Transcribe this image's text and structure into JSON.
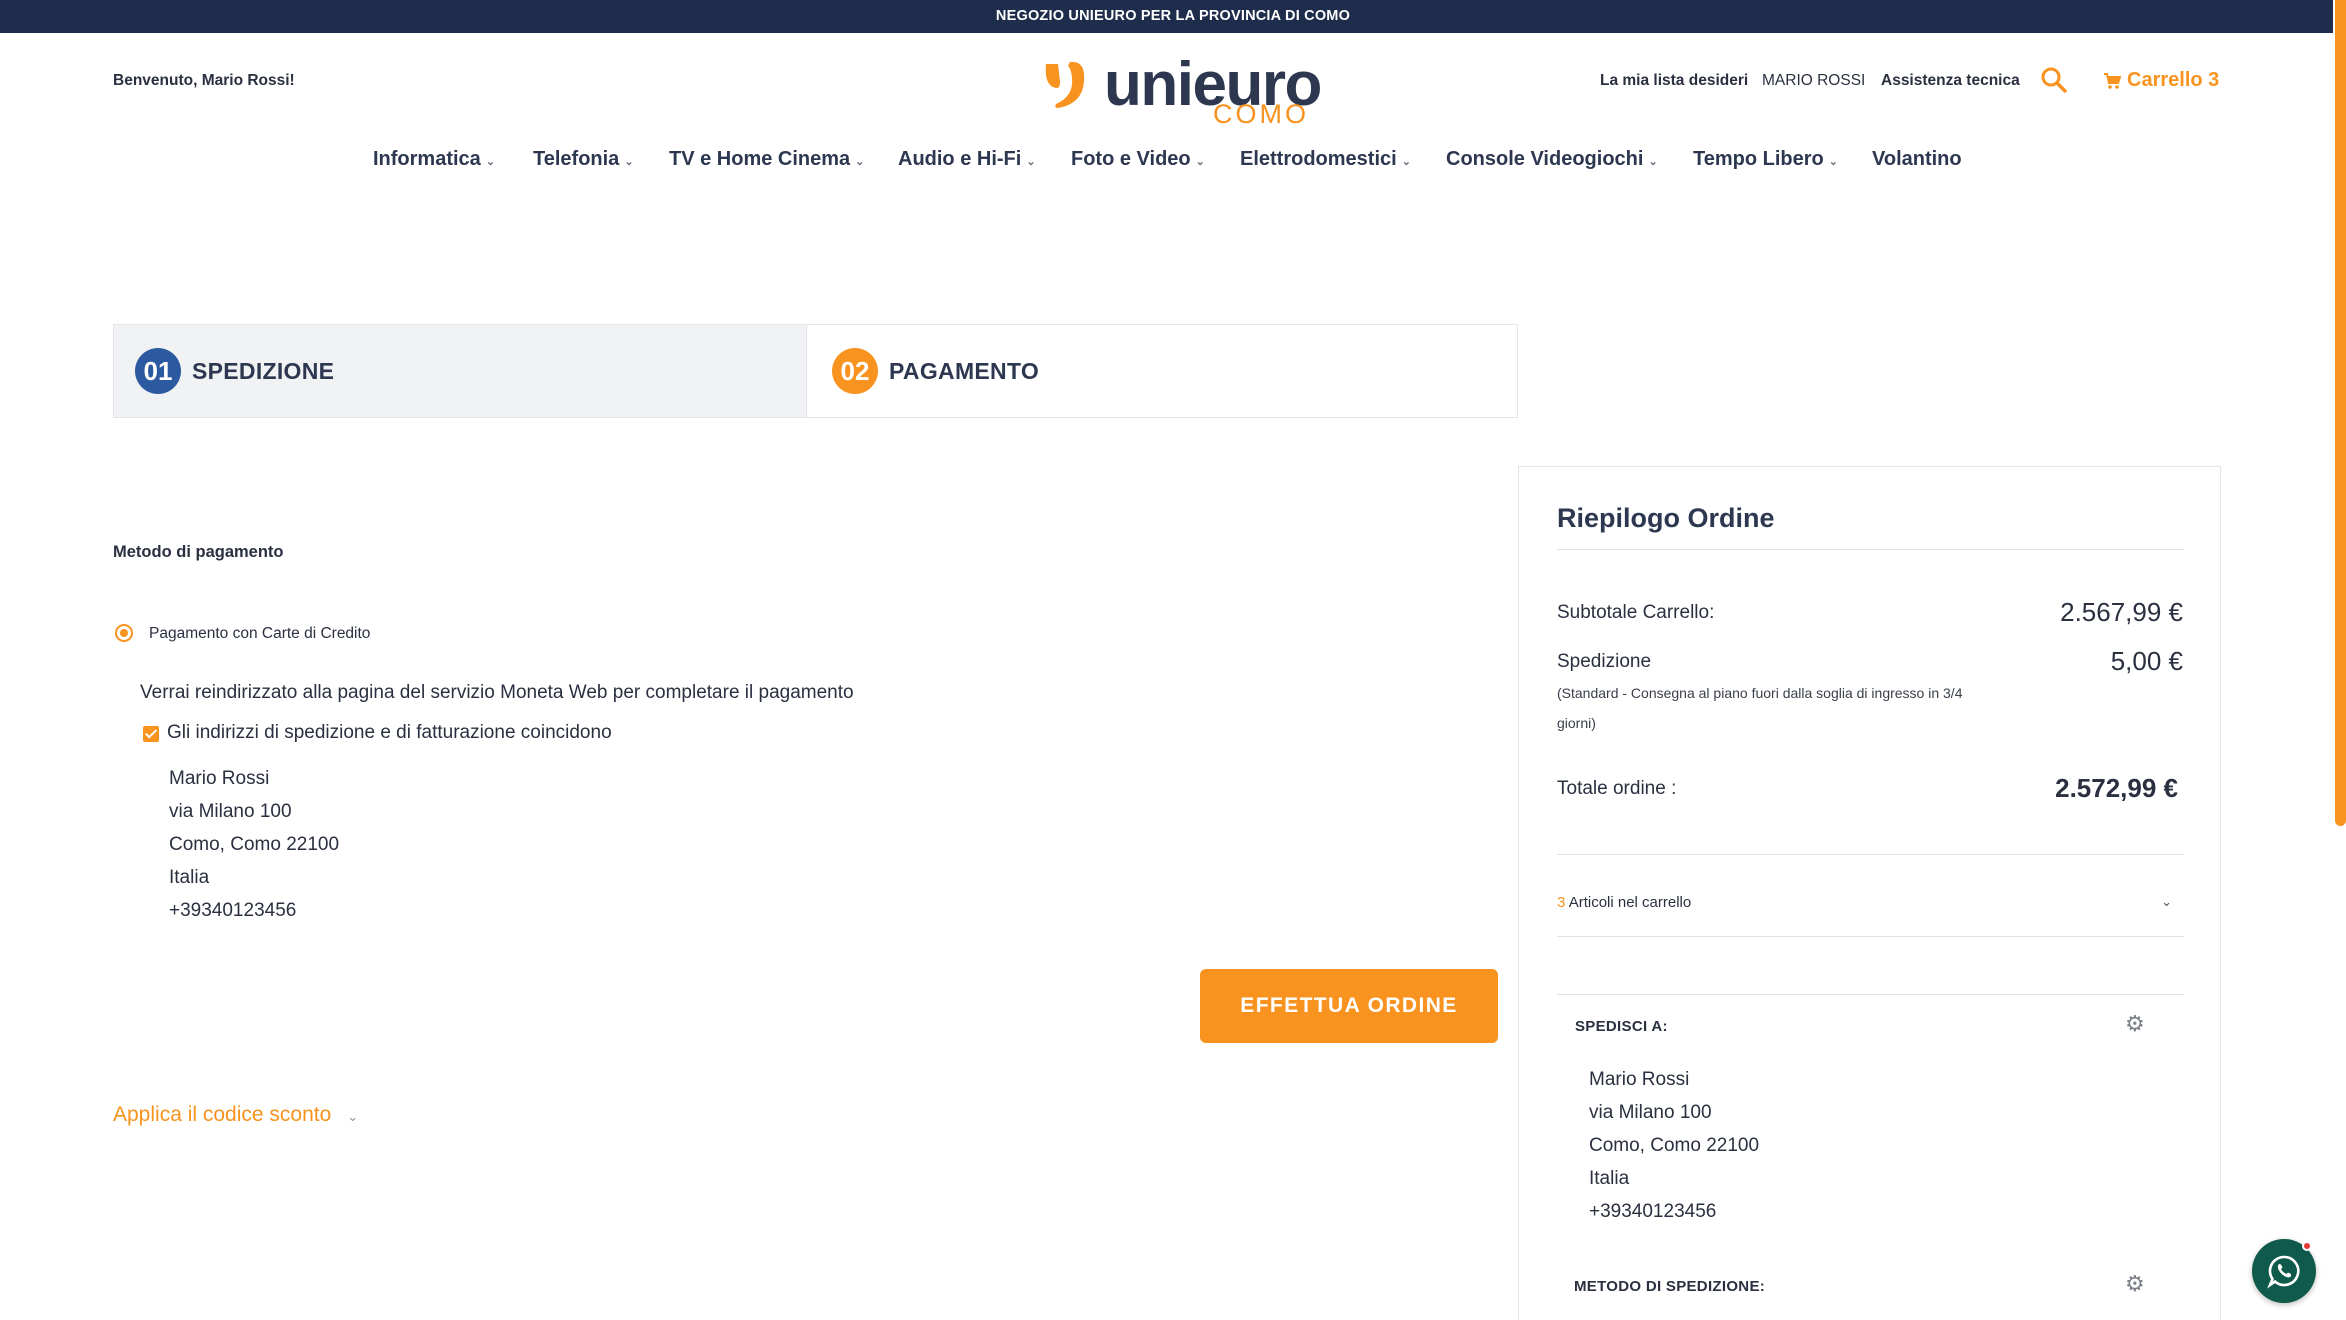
{
  "colors": {
    "accent": "#f7931e",
    "navy": "#1f2d4c",
    "step1": "#2c5aa0",
    "whatsapp": "#0f5a4a"
  },
  "topbar": {
    "text": "NEGOZIO UNIEURO PER LA PROVINCIA DI COMO"
  },
  "header": {
    "welcome": "Benvenuto, Mario Rossi!",
    "logo_word": "unieuro",
    "logo_city": "COMO",
    "wishlist": "La mia lista desideri",
    "user": "MARIO ROSSI",
    "help": "Assistenza tecnica",
    "search_icon": "search-icon",
    "cart_label": "Carrello 3"
  },
  "nav": [
    {
      "label": "Informatica",
      "dropdown": true
    },
    {
      "label": "Telefonia",
      "dropdown": true
    },
    {
      "label": "TV e Home Cinema",
      "dropdown": true
    },
    {
      "label": "Audio e Hi-Fi",
      "dropdown": true
    },
    {
      "label": "Foto e Video",
      "dropdown": true
    },
    {
      "label": "Elettrodomestici",
      "dropdown": true
    },
    {
      "label": "Console Videogiochi",
      "dropdown": true
    },
    {
      "label": "Tempo Libero",
      "dropdown": true
    },
    {
      "label": "Volantino",
      "dropdown": false
    }
  ],
  "steps": [
    {
      "num": "01",
      "label": "SPEDIZIONE"
    },
    {
      "num": "02",
      "label": "PAGAMENTO"
    }
  ],
  "payment": {
    "title": "Metodo di pagamento",
    "option": "Pagamento con Carte di Credito",
    "redirect": "Verrai reindirizzato alla pagina del servizio Moneta Web per completare il pagamento",
    "same_address": "Gli indirizzi di spedizione e di fatturazione coincidono",
    "address": [
      "Mario Rossi",
      "via Milano 100",
      "Como, Como 22100",
      "Italia",
      "+39340123456"
    ],
    "submit": "EFFETTUA ORDINE",
    "discount": "Applica il codice sconto"
  },
  "summary": {
    "title": "Riepilogo Ordine",
    "subtotal_label": "Subtotale Carrello:",
    "subtotal_value": "2.567,99 €",
    "shipping_label": "Spedizione",
    "shipping_value": "5,00 €",
    "shipping_note": "(Standard - Consegna al piano fuori dalla soglia di ingresso in 3/4 giorni)",
    "total_label": "Totale ordine :",
    "total_value": "2.572,99 €",
    "items_count": "3",
    "items_label": "Articoli nel carrello",
    "ship_to_label": "SPEDISCI A:",
    "ship_to_address": [
      "Mario Rossi",
      "via Milano 100",
      "Como, Como 22100",
      "Italia",
      "+39340123456"
    ],
    "ship_method_label": "METODO DI SPEDIZIONE:"
  }
}
